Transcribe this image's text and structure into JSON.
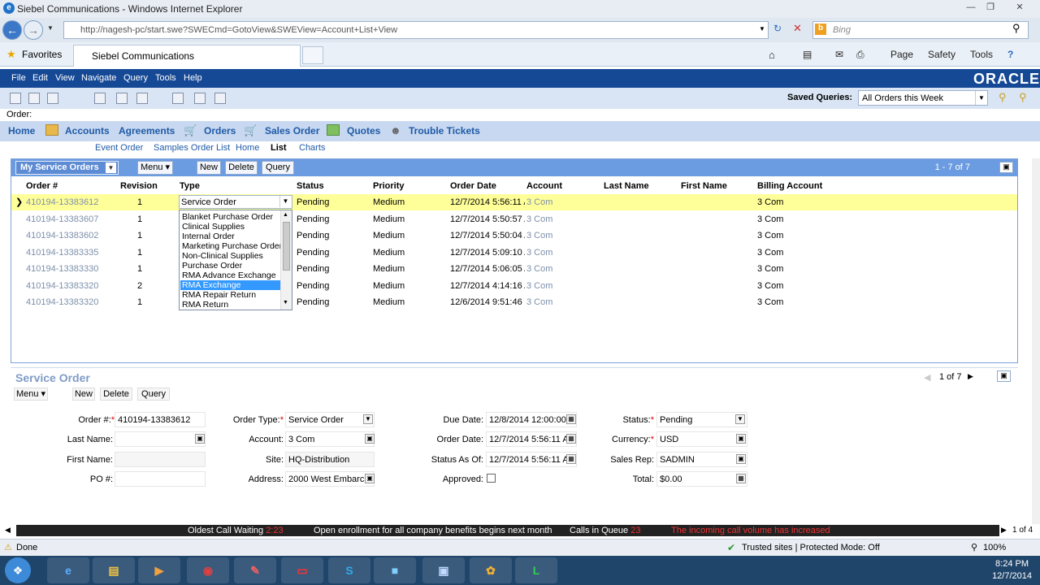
{
  "window": {
    "title": "Siebel Communications - Windows Internet Explorer",
    "url": "http://nagesh-pc/start.swe?SWECmd=GotoView&SWEView=Account+List+View",
    "search_placeholder": "Bing",
    "favorites_label": "Favorites",
    "tab_label": "Siebel Communications",
    "cmd_page": "Page",
    "cmd_safety": "Safety",
    "cmd_tools": "Tools"
  },
  "menu": {
    "items": [
      "File",
      "Edit",
      "View",
      "Navigate",
      "Query",
      "Tools",
      "Help"
    ],
    "brand": "ORACLE"
  },
  "toolbar": {
    "saved_queries_label": "Saved Queries:",
    "saved_queries_value": "All Orders this Week"
  },
  "breadcrumb": "Order:",
  "screen_tabs": [
    "Home",
    "Accounts",
    "Agreements",
    "Orders",
    "Sales Order",
    "Quotes",
    "Trouble Tickets"
  ],
  "view_tabs": [
    "Event Order",
    "Samples Order List",
    "Home",
    "List",
    "Charts"
  ],
  "list": {
    "visibility": "My Service Orders",
    "menu_label": "Menu",
    "new_label": "New",
    "delete_label": "Delete",
    "query_label": "Query",
    "record_count": "1 - 7 of 7",
    "columns": [
      "Order #",
      "Revision",
      "Type",
      "Status",
      "Priority",
      "Order Date",
      "Account",
      "Last Name",
      "First Name",
      "Billing Account"
    ],
    "rows": [
      {
        "order": "410194-13383612",
        "rev": "1",
        "type": "Service Order",
        "status": "Pending",
        "priority": "Medium",
        "date": "12/7/2014 5:56:11 A",
        "account": "3 Com",
        "billing": "3 Com"
      },
      {
        "order": "410194-13383607",
        "rev": "1",
        "type": "",
        "status": "Pending",
        "priority": "Medium",
        "date": "12/7/2014 5:50:57 A",
        "account": "3 Com",
        "billing": "3 Com"
      },
      {
        "order": "410194-13383602",
        "rev": "1",
        "type": "",
        "status": "Pending",
        "priority": "Medium",
        "date": "12/7/2014 5:50:04 A",
        "account": "3 Com",
        "billing": "3 Com"
      },
      {
        "order": "410194-13383335",
        "rev": "1",
        "type": "",
        "status": "Pending",
        "priority": "Medium",
        "date": "12/7/2014 5:09:10 A",
        "account": "3 Com",
        "billing": "3 Com"
      },
      {
        "order": "410194-13383330",
        "rev": "1",
        "type": "",
        "status": "Pending",
        "priority": "Medium",
        "date": "12/7/2014 5:06:05 A",
        "account": "3 Com",
        "billing": "3 Com"
      },
      {
        "order": "410194-13383320",
        "rev": "2",
        "type": "",
        "status": "Pending",
        "priority": "Medium",
        "date": "12/7/2014 4:14:16 A",
        "account": "3 Com",
        "billing": "3 Com"
      },
      {
        "order": "410194-13383320",
        "rev": "1",
        "type": "",
        "status": "Pending",
        "priority": "Medium",
        "date": "12/6/2014 9:51:46 P",
        "account": "3 Com",
        "billing": "3 Com"
      }
    ],
    "type_options": [
      "Blanket Purchase Order",
      "Clinical Supplies",
      "Internal Order",
      "Marketing Purchase Order",
      "Non-Clinical Supplies",
      "Purchase Order",
      "RMA Advance Exchange",
      "RMA Exchange",
      "RMA Repair Return",
      "RMA Return"
    ],
    "type_selected_option": "RMA Exchange"
  },
  "form": {
    "title": "Service Order",
    "menu_label": "Menu",
    "new_label": "New",
    "delete_label": "Delete",
    "query_label": "Query",
    "record_nav": "1 of 7",
    "fields": {
      "order_no_label": "Order #:",
      "order_no": "410194-13383612",
      "last_name_label": "Last Name:",
      "last_name": "",
      "first_name_label": "First Name:",
      "first_name": "",
      "po_label": "PO #:",
      "po": "",
      "order_type_label": "Order Type:",
      "order_type": "Service Order",
      "account_label": "Account:",
      "account": "3 Com",
      "site_label": "Site:",
      "site": "HQ-Distribution",
      "address_label": "Address:",
      "address": "2000 West Embarcad",
      "due_date_label": "Due Date:",
      "due_date": "12/8/2014 12:00:00",
      "order_date_label": "Order Date:",
      "order_date": "12/7/2014 5:56:11 A",
      "status_as_of_label": "Status As Of:",
      "status_as_of": "12/7/2014 5:56:11 A",
      "approved_label": "Approved:",
      "status_label": "Status:",
      "status": "Pending",
      "currency_label": "Currency:",
      "currency": "USD",
      "sales_rep_label": "Sales Rep:",
      "sales_rep": "SADMIN",
      "total_label": "Total:",
      "total": "$0.00"
    }
  },
  "ticker": {
    "item1_label": "Oldest Call Waiting",
    "item1_value": "2:23",
    "item2": "Open enrollment for all company benefits begins next month",
    "item3_label": "Calls in Queue",
    "item3_value": "23",
    "item4": "The incoming call volume has increased",
    "page": "1 of 4"
  },
  "statusbar": {
    "done": "Done",
    "zone": "Trusted sites | Protected Mode: Off",
    "zoom": "100%"
  },
  "clock": {
    "time": "8:24 PM",
    "date": "12/7/2014"
  },
  "colors": {
    "brand_blue": "#154895",
    "selected_row": "#ffff99",
    "applet_header": "#6b9be0"
  }
}
